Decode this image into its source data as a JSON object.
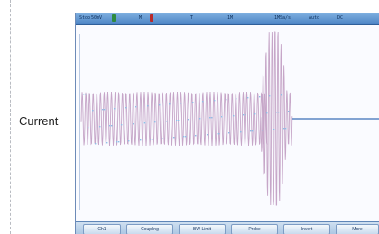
{
  "channel_label": "Current",
  "status_bar": {
    "items": [
      "Stop",
      "50mV",
      "M",
      "T",
      "1M",
      "1MSa/s",
      "Auto",
      "DC"
    ]
  },
  "colors": {
    "status_bar": "#5a8fcc",
    "trace": "#c6a6c8",
    "trace_dots": "#8fbfe8",
    "settled_trace": "#5a86c4"
  },
  "softkeys": [
    "Ch1",
    "Coupling",
    "BW Limit",
    "Probe",
    "Invert",
    "More"
  ],
  "trace": {
    "type": "line",
    "regions": [
      "oscillation",
      "burst",
      "settled"
    ]
  }
}
